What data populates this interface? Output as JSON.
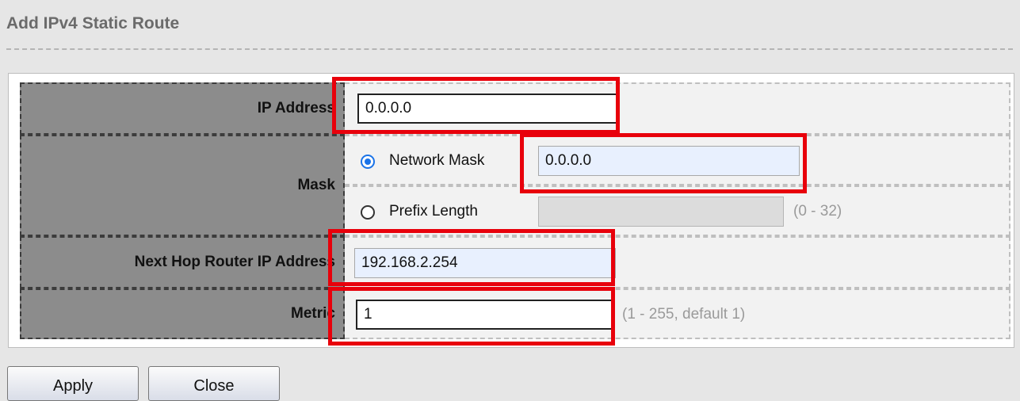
{
  "page": {
    "title": "Add IPv4 Static Route"
  },
  "form": {
    "ip_address": {
      "label": "IP Address",
      "value": "0.0.0.0"
    },
    "mask": {
      "label": "Mask",
      "network_mask": {
        "label": "Network Mask",
        "value": "0.0.0.0",
        "selected": true
      },
      "prefix_length": {
        "label": "Prefix Length",
        "value": "",
        "hint": "(0 - 32)",
        "selected": false
      }
    },
    "next_hop": {
      "label": "Next Hop Router IP Address",
      "value": "192.168.2.254"
    },
    "metric": {
      "label": "Metric",
      "value": "1",
      "hint": "(1 - 255, default 1)"
    }
  },
  "buttons": {
    "apply": "Apply",
    "close": "Close"
  },
  "colors": {
    "highlight": "#e8000b",
    "label_bg": "#8c8c8c",
    "radio_accent": "#1a73e8"
  }
}
